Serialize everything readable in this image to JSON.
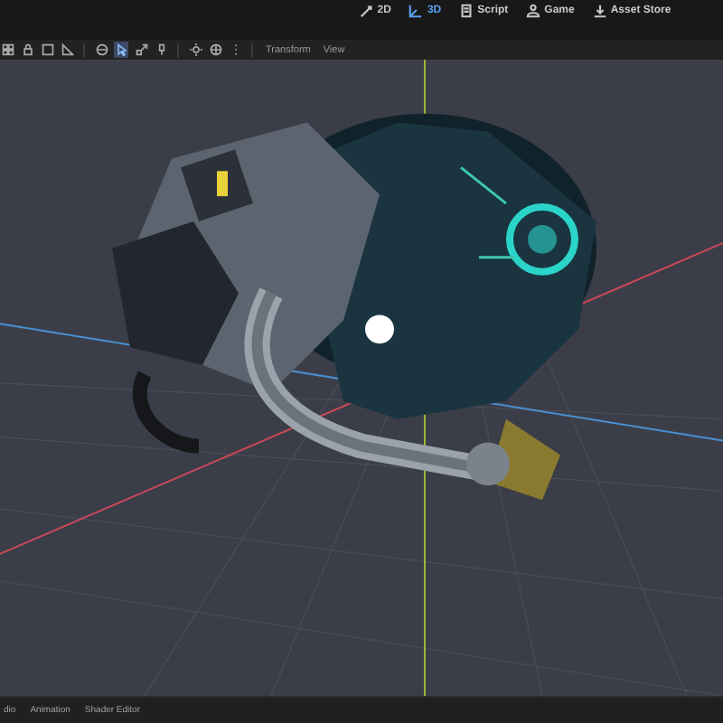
{
  "workspace_tabs": [
    {
      "label": "2D",
      "kind": "twod",
      "selected": false
    },
    {
      "label": "3D",
      "kind": "threed",
      "selected": true
    },
    {
      "label": "Script",
      "kind": "script",
      "selected": false
    },
    {
      "label": "Game",
      "kind": "game",
      "selected": false
    },
    {
      "label": "Asset Store",
      "kind": "store",
      "selected": false
    }
  ],
  "toolbar": {
    "tools": [
      {
        "kind": "grid",
        "selected": false
      },
      {
        "kind": "lock",
        "selected": false
      },
      {
        "kind": "group",
        "selected": false
      },
      {
        "kind": "ruler",
        "selected": false
      },
      {
        "kind": "orbit",
        "selected": false
      },
      {
        "kind": "select",
        "selected": true
      },
      {
        "kind": "scale",
        "selected": false
      },
      {
        "kind": "pin",
        "selected": false
      },
      {
        "kind": "sun",
        "selected": false
      },
      {
        "kind": "globe",
        "selected": false
      },
      {
        "kind": "more",
        "selected": false
      }
    ],
    "menus": [
      "Transform",
      "View"
    ]
  },
  "bottom_tabs": [
    "dio",
    "Animation",
    "Shader Editor"
  ]
}
